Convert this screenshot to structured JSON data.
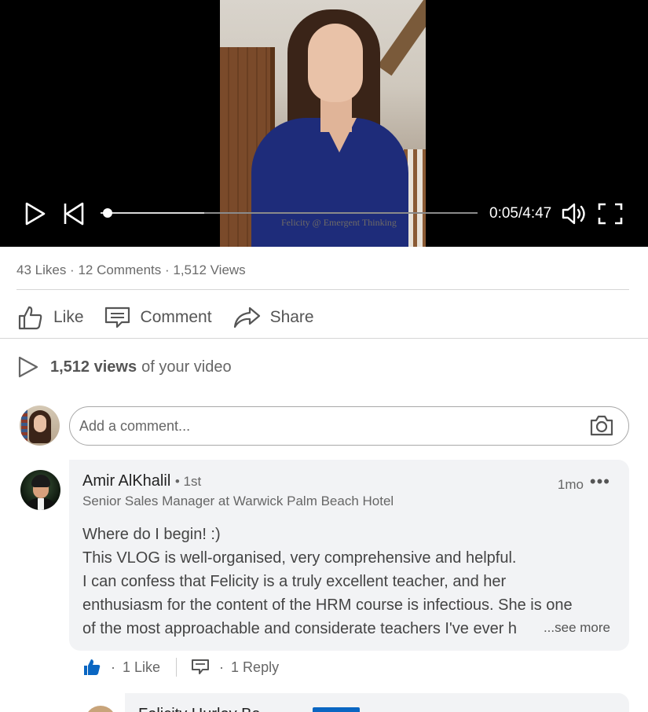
{
  "video": {
    "watermark": "Felicity @ Emergent Thinking",
    "time": "0:05/4:47",
    "progress_fraction": 0.018,
    "buffered_fraction": 0.275
  },
  "stats": {
    "likes": "43 Likes",
    "comments": "12 Comments",
    "views": "1,512 Views",
    "separator": " · "
  },
  "actions": {
    "like": "Like",
    "comment": "Comment",
    "share": "Share"
  },
  "views_summary": {
    "count": "1,512 views",
    "suffix": "of your video"
  },
  "composer": {
    "placeholder": "Add a comment..."
  },
  "comment": {
    "author": "Amir AlKhalil",
    "degree": "• 1st",
    "time": "1mo",
    "more": "•••",
    "headline": "Senior Sales Manager at Warwick Palm Beach Hotel",
    "lines": [
      "Where do I begin! :)",
      "This VLOG is well-organised, very comprehensive and helpful.",
      "I can confess that  Felicity is a truly excellent teacher, and her",
      "enthusiasm for the content of the HRM course  is infectious. She is one",
      "of the most approachable and considerate teachers I've ever h"
    ],
    "see_more": "...see more",
    "likes": "1 Like",
    "replies": "1 Reply",
    "dot": "·"
  },
  "reply": {
    "author_partial": "Felicity Hurley Ba..."
  },
  "colors": {
    "accent": "#0a66c2",
    "bubble": "#f2f3f5",
    "divider": "#d6d6d6"
  }
}
